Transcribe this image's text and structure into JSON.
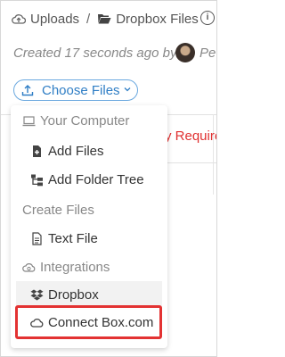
{
  "breadcrumb": {
    "parent": "Uploads",
    "current": "Dropbox Files",
    "separator": "/"
  },
  "info_icon": "i",
  "meta": {
    "created": "Created 17 seconds ago by",
    "user_truncated": "Pe"
  },
  "choose_button": {
    "label": "Choose Files"
  },
  "background": {
    "required_text": "y Require"
  },
  "menu": {
    "sections": [
      {
        "label": "Your Computer",
        "icon": "laptop-icon",
        "items": [
          {
            "label": "Add Files",
            "icon": "file-plus-icon"
          },
          {
            "label": "Add Folder Tree",
            "icon": "folder-tree-icon"
          }
        ]
      },
      {
        "label": "Create Files",
        "icon": "",
        "items": [
          {
            "label": "Text File",
            "icon": "text-file-icon"
          }
        ]
      },
      {
        "label": "Integrations",
        "icon": "cloud-integrations-icon",
        "items": [
          {
            "label": "Dropbox",
            "icon": "dropbox-icon"
          },
          {
            "label": "Connect Box.com",
            "icon": "cloud-icon"
          }
        ]
      }
    ]
  },
  "colors": {
    "accent": "#2f7ec5",
    "highlight": "#e33232",
    "required": "#e03030"
  }
}
